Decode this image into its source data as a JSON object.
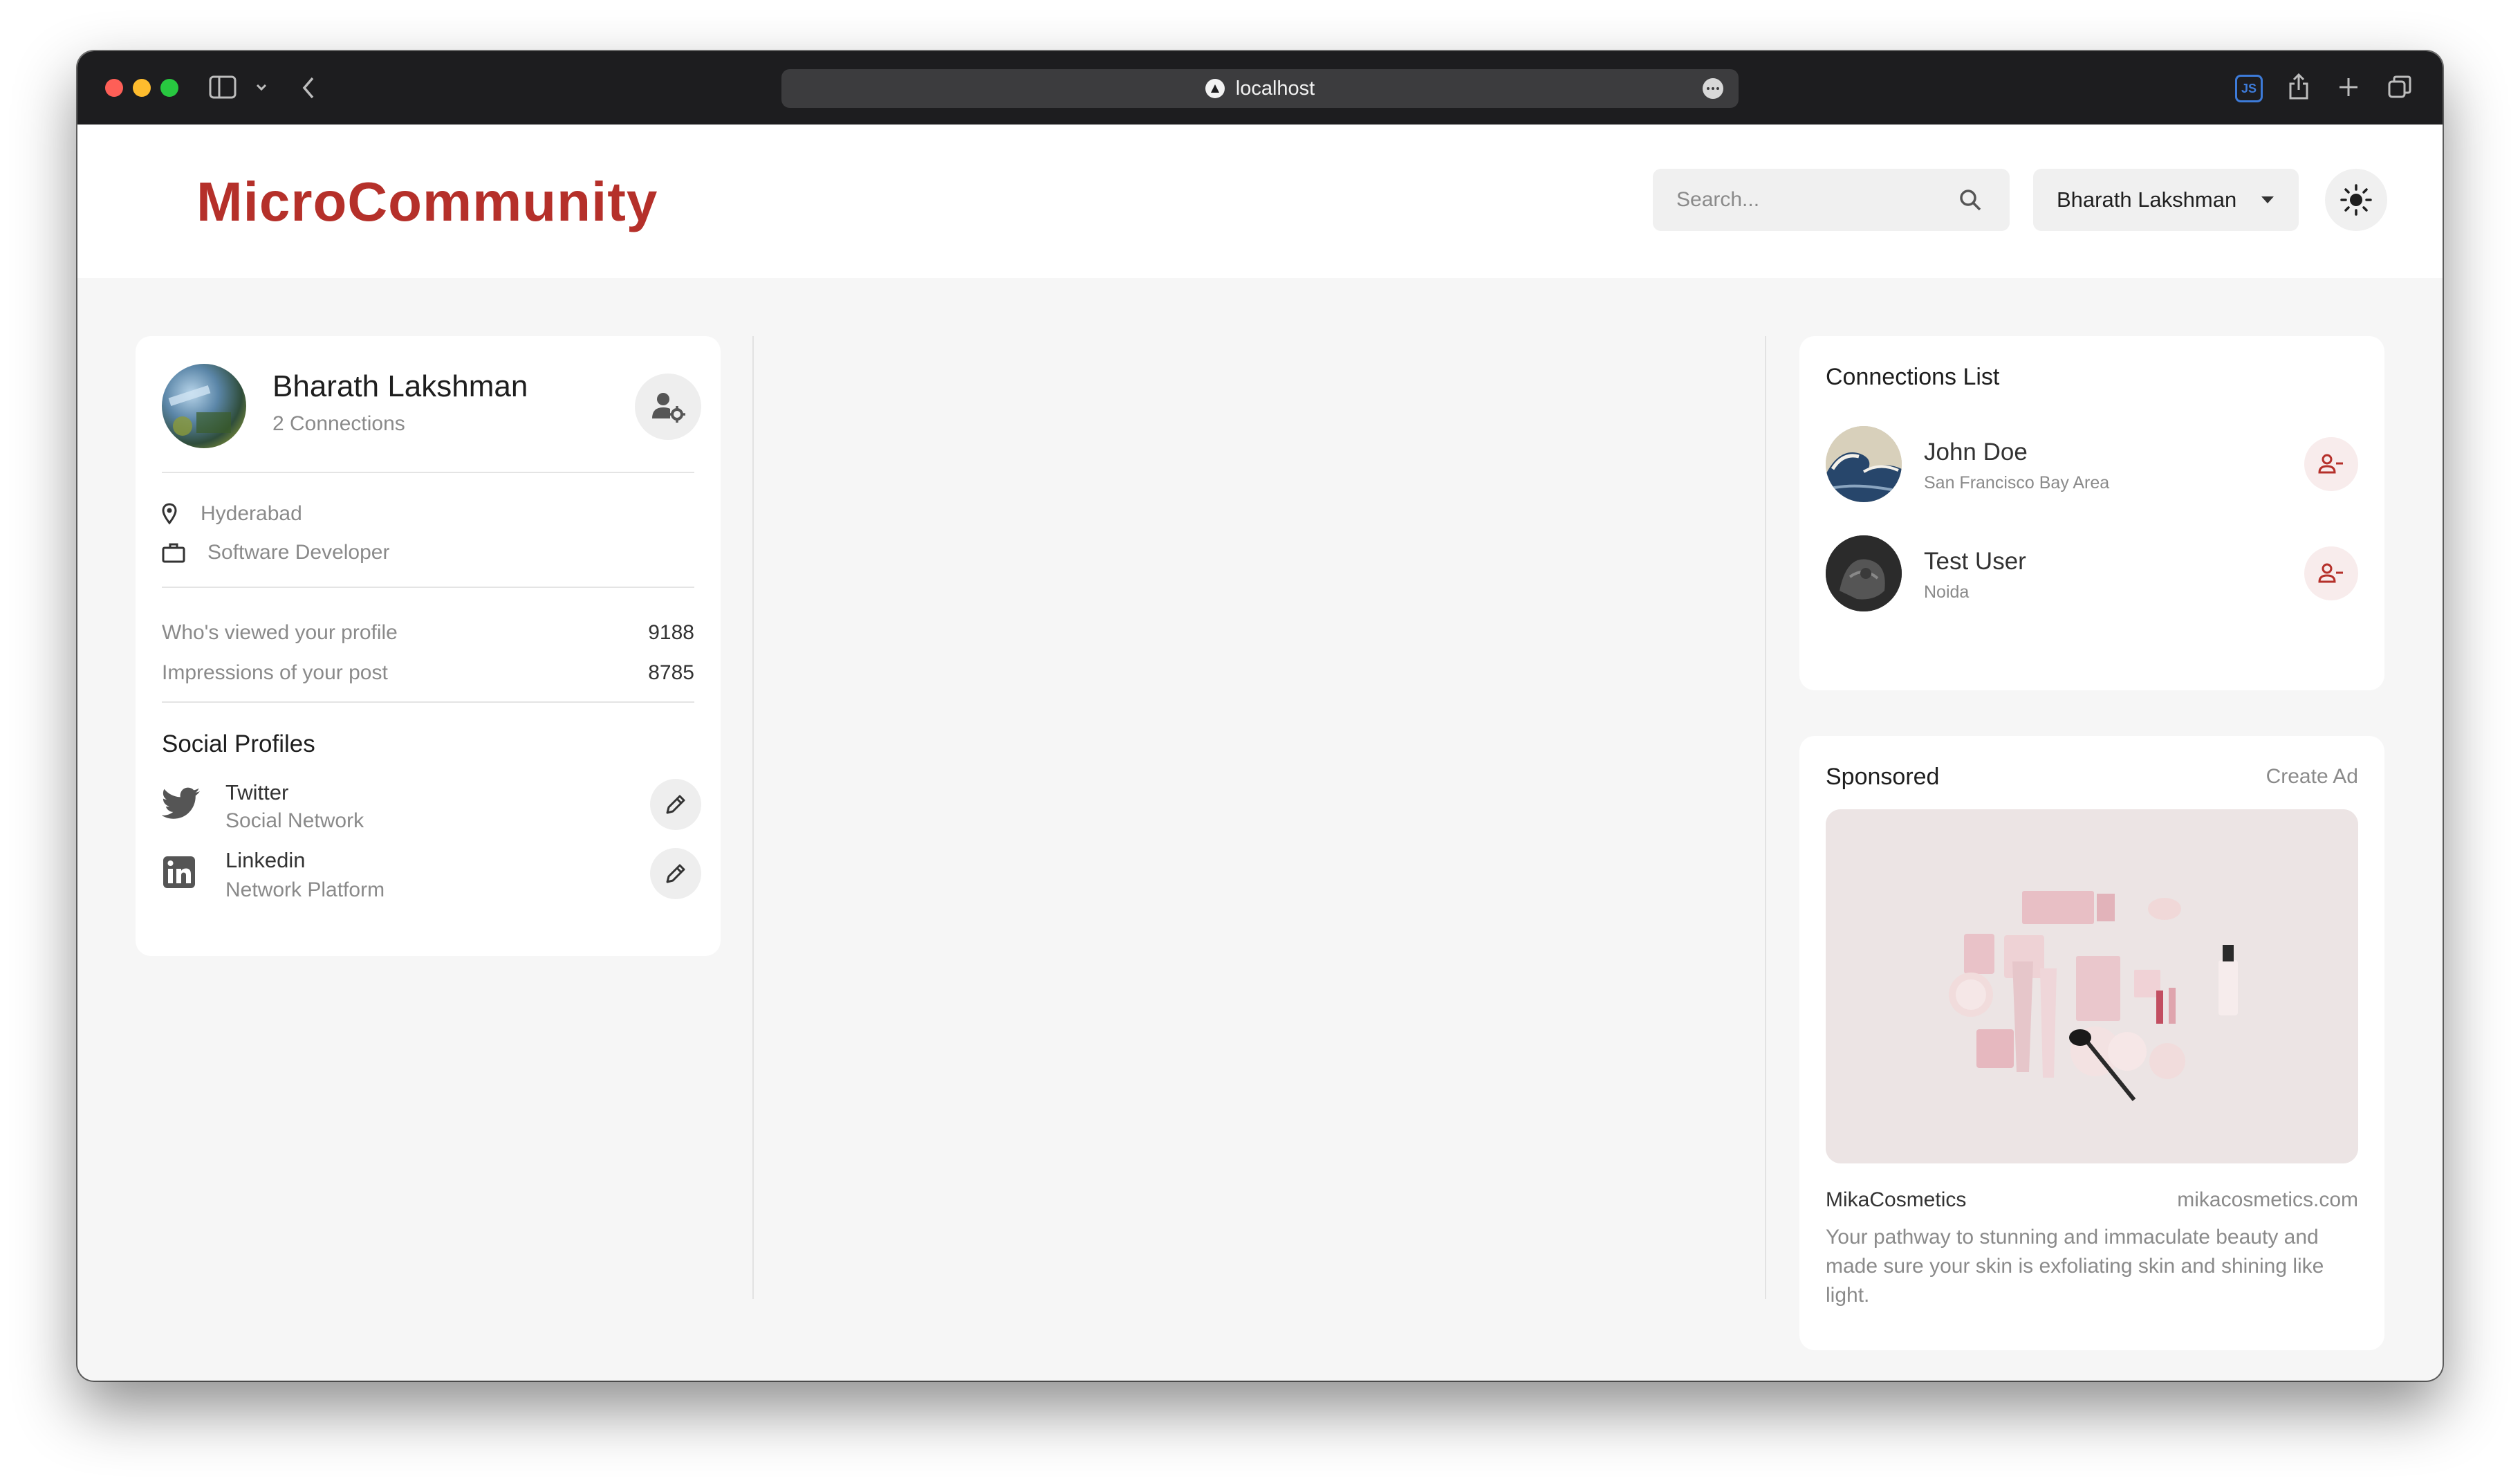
{
  "browser": {
    "url": "localhost",
    "icons": [
      "sidebar-toggle-icon",
      "chevron-down-icon",
      "back-icon",
      "site-icon",
      "more-icon",
      "js-extension-icon",
      "share-icon",
      "new-tab-icon",
      "tabs-overview-icon"
    ]
  },
  "header": {
    "logo": "MicroCommunity",
    "search_placeholder": "Search...",
    "current_user": "Bharath Lakshman"
  },
  "profile": {
    "name": "Bharath Lakshman",
    "connections": "2 Connections",
    "location": "Hyderabad",
    "occupation": "Software Developer",
    "stats": [
      {
        "label": "Who's viewed your profile",
        "value": "9188"
      },
      {
        "label": "Impressions of your post",
        "value": "8785"
      }
    ],
    "social_title": "Social Profiles",
    "socials": [
      {
        "name": "Twitter",
        "type": "Social Network",
        "icon": "twitter-icon"
      },
      {
        "name": "Linkedin",
        "type": "Network Platform",
        "icon": "linkedin-icon"
      }
    ]
  },
  "connections": {
    "title": "Connections List",
    "items": [
      {
        "name": "John Doe",
        "location": "San Francisco Bay Area"
      },
      {
        "name": "Test User",
        "location": "Noida"
      }
    ]
  },
  "sponsored": {
    "title": "Sponsored",
    "create_label": "Create Ad",
    "brand": "MikaCosmetics",
    "url": "mikacosmetics.com",
    "description": "Your pathway to stunning and immaculate beauty and made sure your skin is exfoliating skin and shining like light."
  },
  "colors": {
    "brand": "#b5302a",
    "background": "#f6f6f6",
    "titlebar": "#1d1d1f"
  }
}
